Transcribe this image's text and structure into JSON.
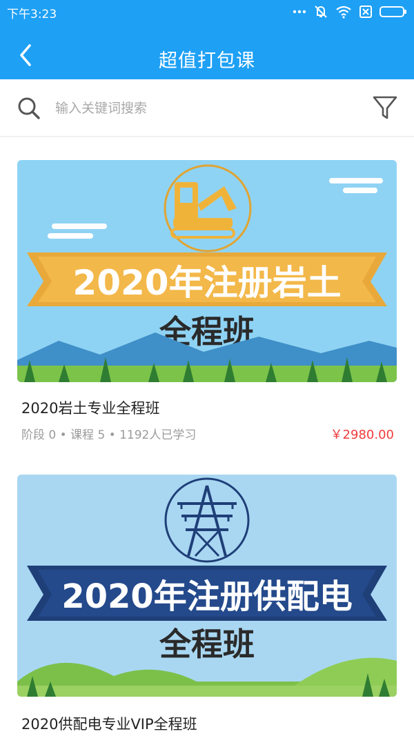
{
  "status_bar": {
    "time": "下午3:23",
    "icons": [
      "more-dots-icon",
      "mute-icon",
      "wifi-icon",
      "sim-off-icon",
      "battery-icon"
    ]
  },
  "nav": {
    "title": "超值打包课",
    "back_icon": "chevron-left-icon"
  },
  "search": {
    "placeholder": "输入关键词搜索",
    "value": "",
    "icon": "search-icon",
    "filter_icon": "filter-icon"
  },
  "colors": {
    "header_bg": "#1ea0f5",
    "price": "#f03c3c",
    "meta": "#9a9a9a"
  },
  "courses": [
    {
      "banner": {
        "headline": "2020年注册岩土",
        "subline": "全程班",
        "ribbon_color": "#e8a93a",
        "icon": "excavator-icon"
      },
      "title": "2020岩土专业全程班",
      "meta": "阶段 0 • 课程 5 • 1192人已学习",
      "price": "￥2980.00"
    },
    {
      "banner": {
        "headline": "2020年注册供配电",
        "subline": "全程班",
        "ribbon_color": "#1f3f78",
        "icon": "power-tower-icon"
      },
      "title": "2020供配电专业VIP全程班"
    }
  ]
}
